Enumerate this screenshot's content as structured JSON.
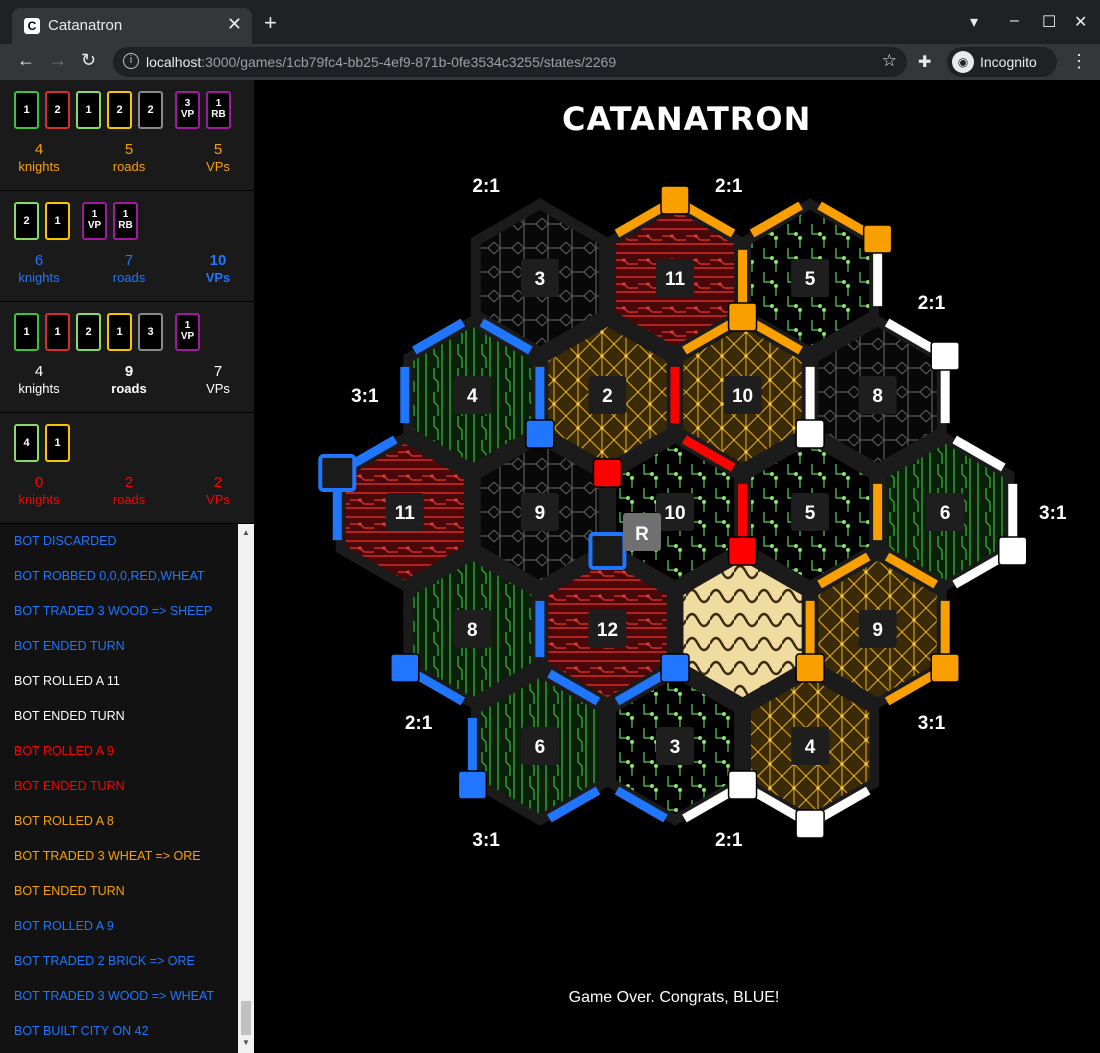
{
  "browser": {
    "tab_title": "Catanatron",
    "tab_favicon": "C",
    "url_host": "localhost",
    "url_path": ":3000/games/1cb79fc4-bb25-4ef9-871b-0fe3534c3255/states/2269",
    "incognito_label": "Incognito"
  },
  "players": [
    {
      "color": "#f9a000",
      "cards": [
        {
          "count": "1",
          "resource": "wood",
          "border": "#3ec23e"
        },
        {
          "count": "2",
          "resource": "brick",
          "border": "#d32f2f"
        },
        {
          "count": "1",
          "resource": "sheep",
          "border": "#8bd96b"
        },
        {
          "count": "2",
          "resource": "wheat",
          "border": "#f9c400"
        },
        {
          "count": "2",
          "resource": "ore",
          "border": "#8a8a8a"
        }
      ],
      "dev_cards": [
        {
          "line1": "3",
          "line2": "VP"
        },
        {
          "line1": "1",
          "line2": "RB"
        }
      ],
      "knights": "4",
      "knights_label": "knights",
      "roads": "5",
      "roads_label": "roads",
      "vps": "5",
      "vps_label": "VPs",
      "bold_roads": false,
      "bold_vps": false
    },
    {
      "color": "#2176ff",
      "cards": [
        {
          "count": "2",
          "resource": "sheep",
          "border": "#8bd96b"
        },
        {
          "count": "1",
          "resource": "wheat",
          "border": "#f9c400"
        }
      ],
      "dev_cards": [
        {
          "line1": "1",
          "line2": "VP"
        },
        {
          "line1": "1",
          "line2": "RB"
        }
      ],
      "knights": "6",
      "knights_label": "knights",
      "roads": "7",
      "roads_label": "roads",
      "vps": "10",
      "vps_label": "VPs",
      "bold_roads": false,
      "bold_vps": true
    },
    {
      "color": "#ffffff",
      "cards": [
        {
          "count": "1",
          "resource": "wood",
          "border": "#3ec23e"
        },
        {
          "count": "1",
          "resource": "brick",
          "border": "#d32f2f"
        },
        {
          "count": "2",
          "resource": "sheep",
          "border": "#8bd96b"
        },
        {
          "count": "1",
          "resource": "wheat",
          "border": "#f9c400"
        },
        {
          "count": "3",
          "resource": "ore",
          "border": "#8a8a8a"
        }
      ],
      "dev_cards": [
        {
          "line1": "1",
          "line2": "VP"
        }
      ],
      "knights": "4",
      "knights_label": "knights",
      "roads": "9",
      "roads_label": "roads",
      "vps": "7",
      "vps_label": "VPs",
      "bold_roads": true,
      "bold_vps": false
    },
    {
      "color": "#ff0000",
      "cards": [
        {
          "count": "4",
          "resource": "sheep",
          "border": "#8bd96b"
        },
        {
          "count": "1",
          "resource": "wheat",
          "border": "#f9c400"
        }
      ],
      "dev_cards": [],
      "knights": "0",
      "knights_label": "knights",
      "roads": "2",
      "roads_label": "roads",
      "vps": "2",
      "vps_label": "VPs",
      "bold_roads": false,
      "bold_vps": false
    }
  ],
  "log": [
    {
      "text": "BOT DISCARDED",
      "color": "#2176ff"
    },
    {
      "text": "BOT ROBBED 0,0,0,RED,WHEAT",
      "color": "#2176ff"
    },
    {
      "text": "BOT TRADED 3 WOOD => SHEEP",
      "color": "#2176ff"
    },
    {
      "text": "BOT ENDED TURN",
      "color": "#2176ff"
    },
    {
      "text": "BOT ROLLED A 11",
      "color": "#ffffff"
    },
    {
      "text": "BOT ENDED TURN",
      "color": "#ffffff"
    },
    {
      "text": "BOT ROLLED A 9",
      "color": "#ff0000"
    },
    {
      "text": "BOT ENDED TURN",
      "color": "#ff0000"
    },
    {
      "text": "BOT ROLLED A 8",
      "color": "#f9a000"
    },
    {
      "text": "BOT TRADED 3 WHEAT => ORE",
      "color": "#f9a000"
    },
    {
      "text": "BOT ENDED TURN",
      "color": "#f9a000"
    },
    {
      "text": "BOT ROLLED A 9",
      "color": "#2176ff"
    },
    {
      "text": "BOT TRADED 2 BRICK => ORE",
      "color": "#2176ff"
    },
    {
      "text": "BOT TRADED 3 WOOD => WHEAT",
      "color": "#2176ff"
    },
    {
      "text": "BOT BUILT CITY ON 42",
      "color": "#2176ff"
    }
  ],
  "board": {
    "title": "CATANATRON",
    "robber_label": "R",
    "game_over": "Game Over. Congrats, BLUE!",
    "tiles": [
      {
        "q": 0,
        "r": -2,
        "resource": "ore",
        "number": "3"
      },
      {
        "q": 1,
        "r": -2,
        "resource": "brick",
        "number": "11"
      },
      {
        "q": 2,
        "r": -2,
        "resource": "sheep",
        "number": "5"
      },
      {
        "q": -1,
        "r": -1,
        "resource": "wood",
        "number": "4"
      },
      {
        "q": 0,
        "r": -1,
        "resource": "wheat",
        "number": "2"
      },
      {
        "q": 1,
        "r": -1,
        "resource": "wheat",
        "number": "10"
      },
      {
        "q": 2,
        "r": -1,
        "resource": "ore",
        "number": "8"
      },
      {
        "q": -2,
        "r": 0,
        "resource": "brick",
        "number": "11"
      },
      {
        "q": -1,
        "r": 0,
        "resource": "ore",
        "number": "9"
      },
      {
        "q": 0,
        "r": 0,
        "resource": "sheep",
        "number": "10"
      },
      {
        "q": 1,
        "r": 0,
        "resource": "sheep",
        "number": "5"
      },
      {
        "q": 2,
        "r": 0,
        "resource": "wood",
        "number": "6"
      },
      {
        "q": -2,
        "r": 1,
        "resource": "wood",
        "number": "8"
      },
      {
        "q": -1,
        "r": 1,
        "resource": "brick",
        "number": "12"
      },
      {
        "q": 0,
        "r": 1,
        "resource": "desert",
        "number": ""
      },
      {
        "q": 1,
        "r": 1,
        "resource": "wheat",
        "number": "9"
      },
      {
        "q": -2,
        "r": 2,
        "resource": "wood",
        "number": "6"
      },
      {
        "q": -1,
        "r": 2,
        "resource": "sheep",
        "number": "3"
      },
      {
        "q": 0,
        "r": 2,
        "resource": "wheat",
        "number": "4"
      }
    ],
    "ports": [
      {
        "label": "2:1"
      },
      {
        "label": "2:1"
      },
      {
        "label": "2:1"
      },
      {
        "label": "3:1"
      },
      {
        "label": "3:1"
      },
      {
        "label": "2:1"
      },
      {
        "label": "3:1"
      },
      {
        "label": "3:1"
      },
      {
        "label": "2:1"
      }
    ],
    "colors": {
      "orange": "#f9a000",
      "blue": "#2176ff",
      "white": "#ffffff",
      "red": "#ff0000",
      "hex_border": "#1b1b1b",
      "number_bg": "#1e1e1e"
    }
  }
}
